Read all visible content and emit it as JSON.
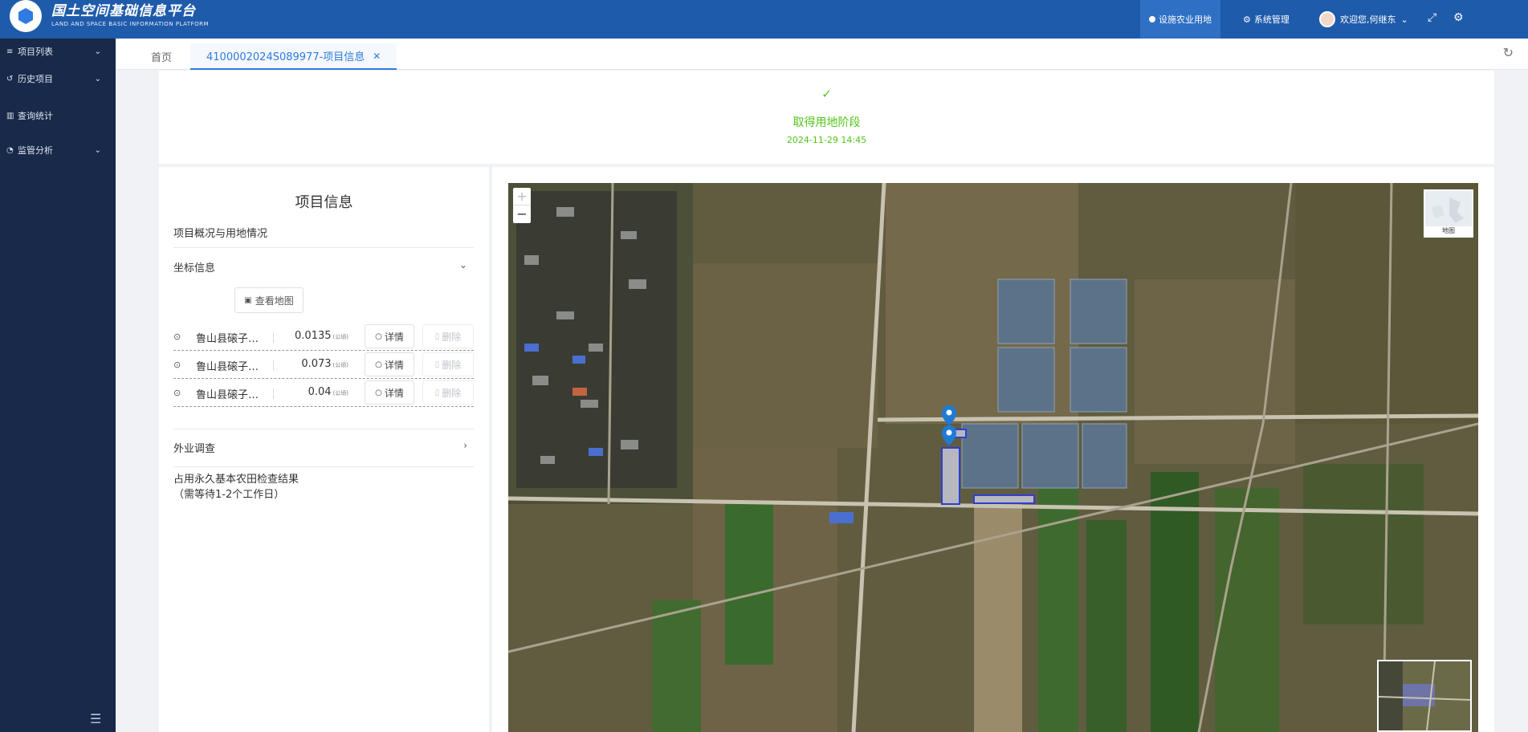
{
  "header": {
    "title": "国土空间基础信息平台",
    "subtitle": "LAND AND SPACE BASIC INFORMATION PLATFORM",
    "nav_active": "设施农业用地",
    "nav_system": "系统管理",
    "user_greeting": "欢迎您,何继东"
  },
  "sidebar": {
    "items": [
      {
        "label": "项目列表",
        "icon": "list-icon"
      },
      {
        "label": "历史项目",
        "icon": "history-icon"
      },
      {
        "label": "查询统计",
        "icon": "bar-chart-icon"
      },
      {
        "label": "监管分析",
        "icon": "pie-chart-icon"
      }
    ]
  },
  "tabs": {
    "home": "首页",
    "active": "4100002024S089977-项目信息"
  },
  "stage": {
    "title": "取得用地阶段",
    "date": "2024-11-29 14:45",
    "color": "#52c41a"
  },
  "panel": {
    "title": "项目信息",
    "overview_section": "项目概况与用地情况",
    "coord_section": "坐标信息",
    "view_map_button": "查看地图",
    "coords": [
      {
        "name": "鲁山县磙子营乡",
        "area": "0.0135",
        "unit": "(公顷)",
        "detail": "详情",
        "delete": "删除"
      },
      {
        "name": "鲁山县磙子营乡",
        "area": "0.073",
        "unit": "(公顷)",
        "detail": "详情",
        "delete": "删除"
      },
      {
        "name": "鲁山县磙子营乡",
        "area": "0.04",
        "unit": "(公顷)",
        "detail": "详情",
        "delete": "删除"
      }
    ],
    "field_survey": "外业调查",
    "result_line1": "占用永久基本农田检查结果",
    "result_line2": "（需等待1-2个工作日）"
  },
  "map": {
    "zoom_in": "+",
    "zoom_out": "−",
    "layer_label": "地图"
  }
}
